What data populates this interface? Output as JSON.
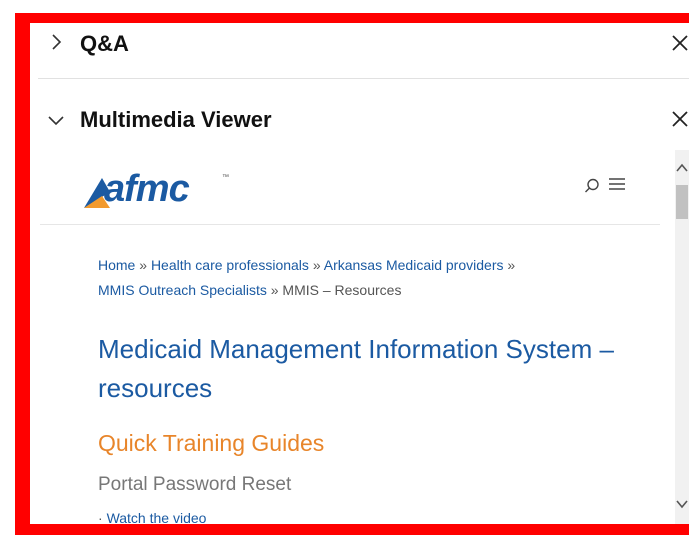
{
  "panels": {
    "qa": {
      "title": "Q&A",
      "chevron": "›",
      "close": "✕"
    },
    "multimedia": {
      "title": "Multimedia Viewer",
      "chevron": "⌄",
      "close": "✕"
    }
  },
  "site": {
    "logo_text": "afmc",
    "logo_tm": "™",
    "brand_color": "#1b5aa2",
    "accent_color": "#e8852a"
  },
  "breadcrumb": {
    "items": [
      "Home",
      "Health care professionals",
      "Arkansas Medicaid providers",
      "MMIS Outreach Specialists"
    ],
    "separator": "»",
    "current": "MMIS – Resources"
  },
  "page": {
    "title": "Medicaid Management Information System – resources",
    "section_heading": "Quick Training Guides",
    "sub_heading": "Portal Password Reset",
    "bullet_marker": "·",
    "bullet_link": "Watch the video"
  },
  "icons": {
    "search": "search-icon",
    "menu": "menu-icon"
  }
}
